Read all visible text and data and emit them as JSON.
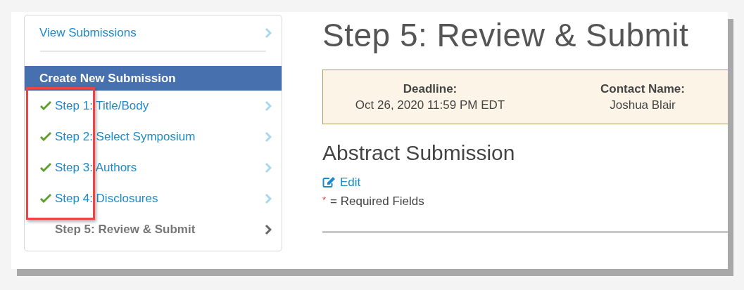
{
  "sidebar": {
    "top_link": "View Submissions",
    "section_header": "Create New Submission",
    "steps": [
      {
        "label": "Step 1: Title/Body",
        "completed": true
      },
      {
        "label": "Step 2: Select Symposium",
        "completed": true
      },
      {
        "label": "Step 3: Authors",
        "completed": true
      },
      {
        "label": "Step 4: Disclosures",
        "completed": true
      },
      {
        "label": "Step 5: Review & Submit",
        "completed": false
      }
    ]
  },
  "main": {
    "title": "Step 5: Review & Submit",
    "info_box": [
      {
        "label": "Deadline:",
        "value": "Oct 26, 2020 11:59 PM EDT"
      },
      {
        "label": "Contact Name:",
        "value": "Joshua Blair"
      }
    ],
    "section_title": "Abstract Submission",
    "edit_link": "Edit",
    "required_marker": "*",
    "required_note": "= Required Fields"
  }
}
